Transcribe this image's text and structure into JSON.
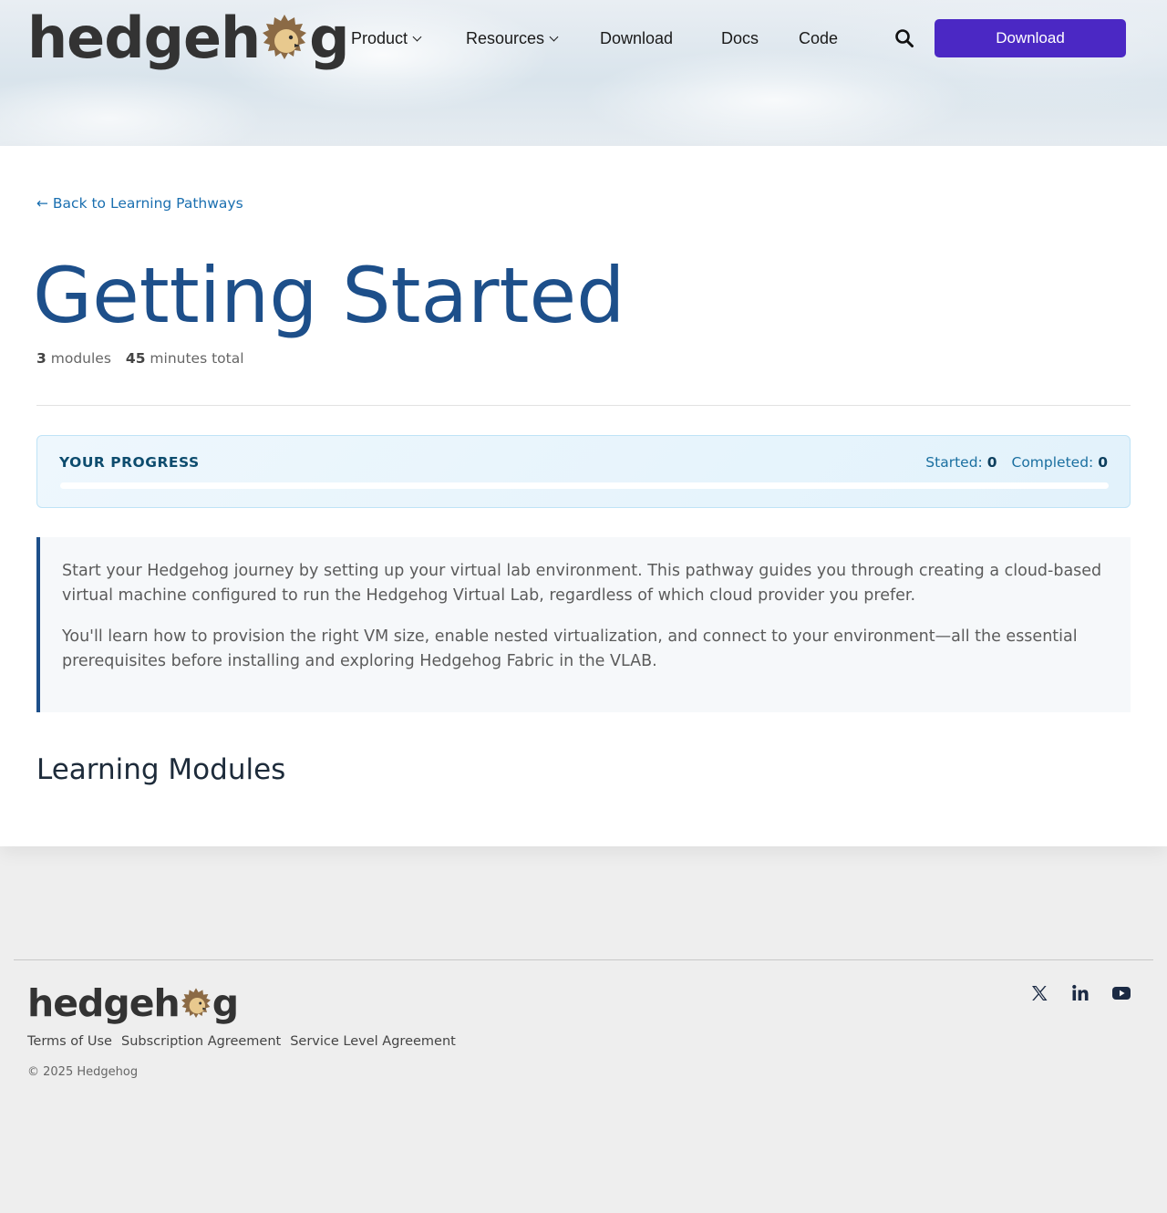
{
  "brand": {
    "logo_text_before": "hedgeh",
    "logo_text_after": "g",
    "colors": {
      "accent": "#4b28c4",
      "title": "#1d4f8a",
      "link": "#1a6fb0",
      "logo_dark": "#333333",
      "logo_brown": "#8b6a45"
    }
  },
  "nav": {
    "items": [
      {
        "label": "Product",
        "has_dropdown": true
      },
      {
        "label": "Resources",
        "has_dropdown": true
      },
      {
        "label": "Download",
        "has_dropdown": false
      },
      {
        "label": "Docs",
        "has_dropdown": false
      },
      {
        "label": "Code",
        "has_dropdown": false
      }
    ],
    "search_icon": "search-icon",
    "cta_label": "Download"
  },
  "main": {
    "back_link": "← Back to Learning Pathways",
    "title": "Getting Started",
    "meta": {
      "modules_count": "3",
      "modules_label": "modules",
      "minutes_count": "45",
      "minutes_label": "minutes total"
    },
    "progress": {
      "title": "YOUR PROGRESS",
      "started_label": "Started:",
      "started_value": "0",
      "completed_label": "Completed:",
      "completed_value": "0",
      "fraction": 0
    },
    "intro": [
      "Start your Hedgehog journey by setting up your virtual lab environment. This pathway guides you through creating a cloud-based virtual machine configured to run the Hedgehog Virtual Lab, regardless of which cloud provider you prefer.",
      "You'll learn how to provision the right VM size, enable nested virtualization, and connect to your environment—all the essential prerequisites before installing and exploring Hedgehog Fabric in the VLAB."
    ],
    "section_title": "Learning Modules"
  },
  "footer": {
    "links": [
      "Terms of Use",
      "Subscription Agreement",
      "Service Level Agreement"
    ],
    "copyright": "© 2025 Hedgehog",
    "social": [
      "x-twitter-icon",
      "linkedin-icon",
      "youtube-icon"
    ]
  }
}
